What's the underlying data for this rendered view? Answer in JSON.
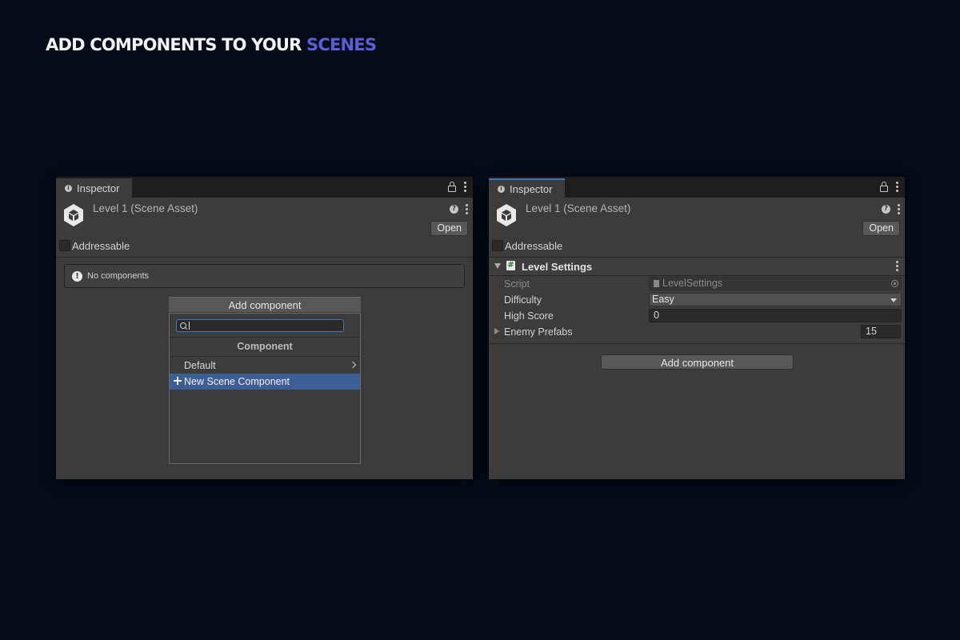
{
  "headline": {
    "prefix": "ADD COMPONENTS TO YOUR ",
    "accent": "SCENES"
  },
  "colors": {
    "background": "#050c18",
    "accent": "#5b5fd6",
    "selection": "#3e5f96",
    "focus": "#3a79bb"
  },
  "left_panel": {
    "tab_label": "Inspector",
    "asset_title": "Level 1 (Scene Asset)",
    "open_label": "Open",
    "addressable_label": "Addressable",
    "addressable_checked": false,
    "help_message": "No components",
    "add_component_label": "Add component",
    "dropdown": {
      "search_value": "",
      "header": "Component",
      "items": [
        {
          "label": "Default",
          "icon": "chevron-right-icon"
        },
        {
          "label": "New Scene Component",
          "icon": "plus-icon",
          "selected": true
        }
      ]
    }
  },
  "right_panel": {
    "tab_label": "Inspector",
    "asset_title": "Level 1 (Scene Asset)",
    "open_label": "Open",
    "addressable_label": "Addressable",
    "addressable_checked": false,
    "component": {
      "title": "Level Settings",
      "properties": {
        "script": {
          "label": "Script",
          "value": "LevelSettings"
        },
        "difficulty": {
          "label": "Difficulty",
          "value": "Easy"
        },
        "high_score": {
          "label": "High Score",
          "value": "0"
        },
        "enemy_prefabs": {
          "label": "Enemy Prefabs",
          "value": "15"
        }
      }
    },
    "add_component_label": "Add component"
  }
}
